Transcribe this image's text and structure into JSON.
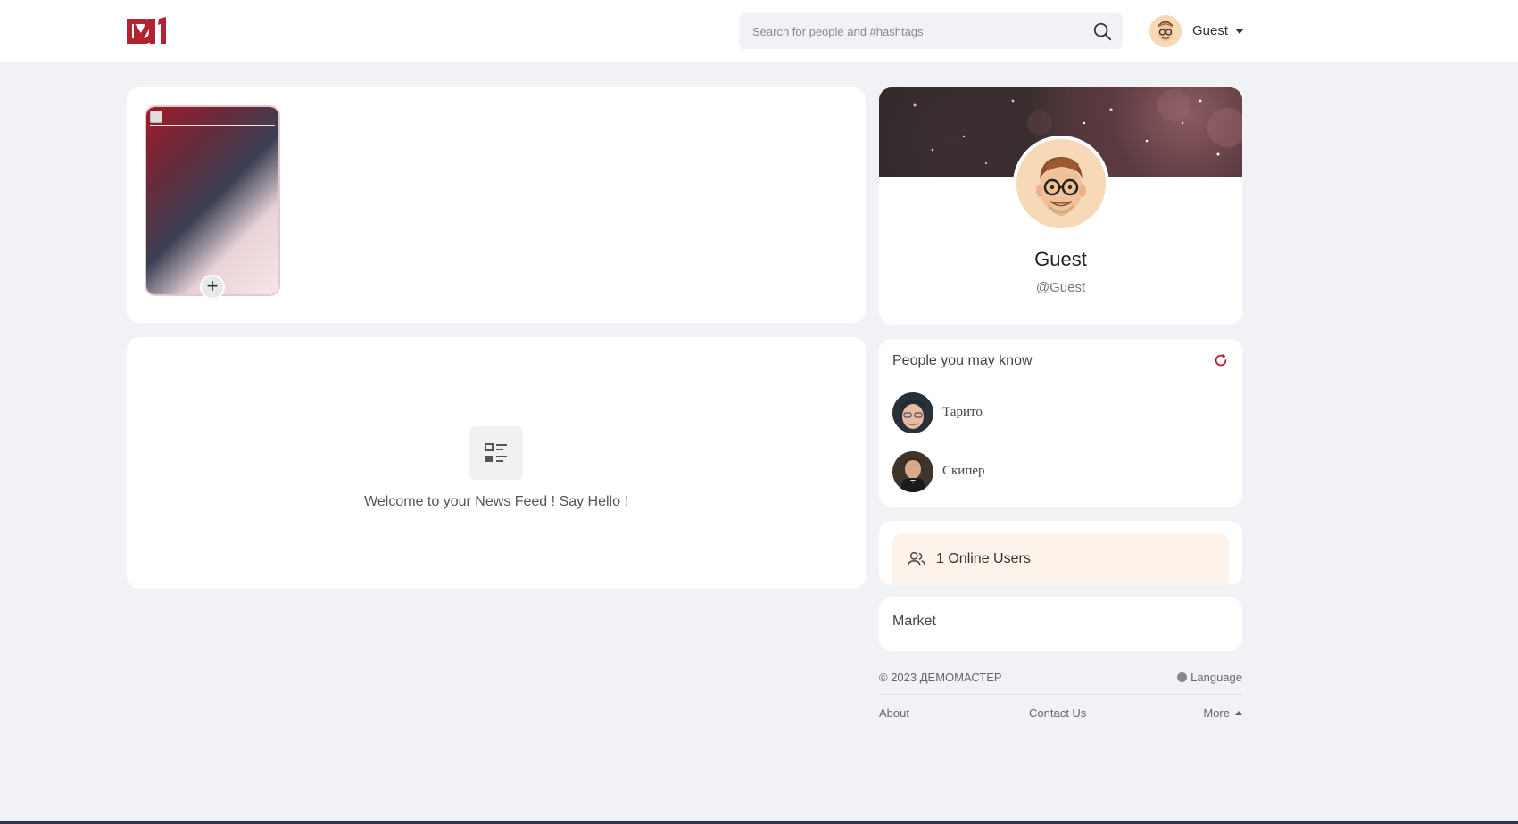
{
  "header": {
    "logo_text": "DM",
    "search_placeholder": "Search for people and #hashtags",
    "user_name": "Guest"
  },
  "stories": {
    "add_label": "+"
  },
  "feed": {
    "empty_message": "Welcome to your News Feed ! Say Hello !"
  },
  "profile": {
    "name": "Guest",
    "handle": "@Guest"
  },
  "people_you_may_know": {
    "title": "People you may know",
    "people": [
      {
        "name": "Тарито"
      },
      {
        "name": "Скипер"
      }
    ]
  },
  "online": {
    "label": "1 Online Users"
  },
  "market": {
    "label": "Market"
  },
  "footer": {
    "copyright": "© 2023 ДЕМОМАСТЕР",
    "language": "Language",
    "about": "About",
    "contact": "Contact Us",
    "more": "More"
  },
  "colors": {
    "brand": "#b2232f",
    "background": "#f0f2f5",
    "online_bg": "#fdf3ea"
  }
}
